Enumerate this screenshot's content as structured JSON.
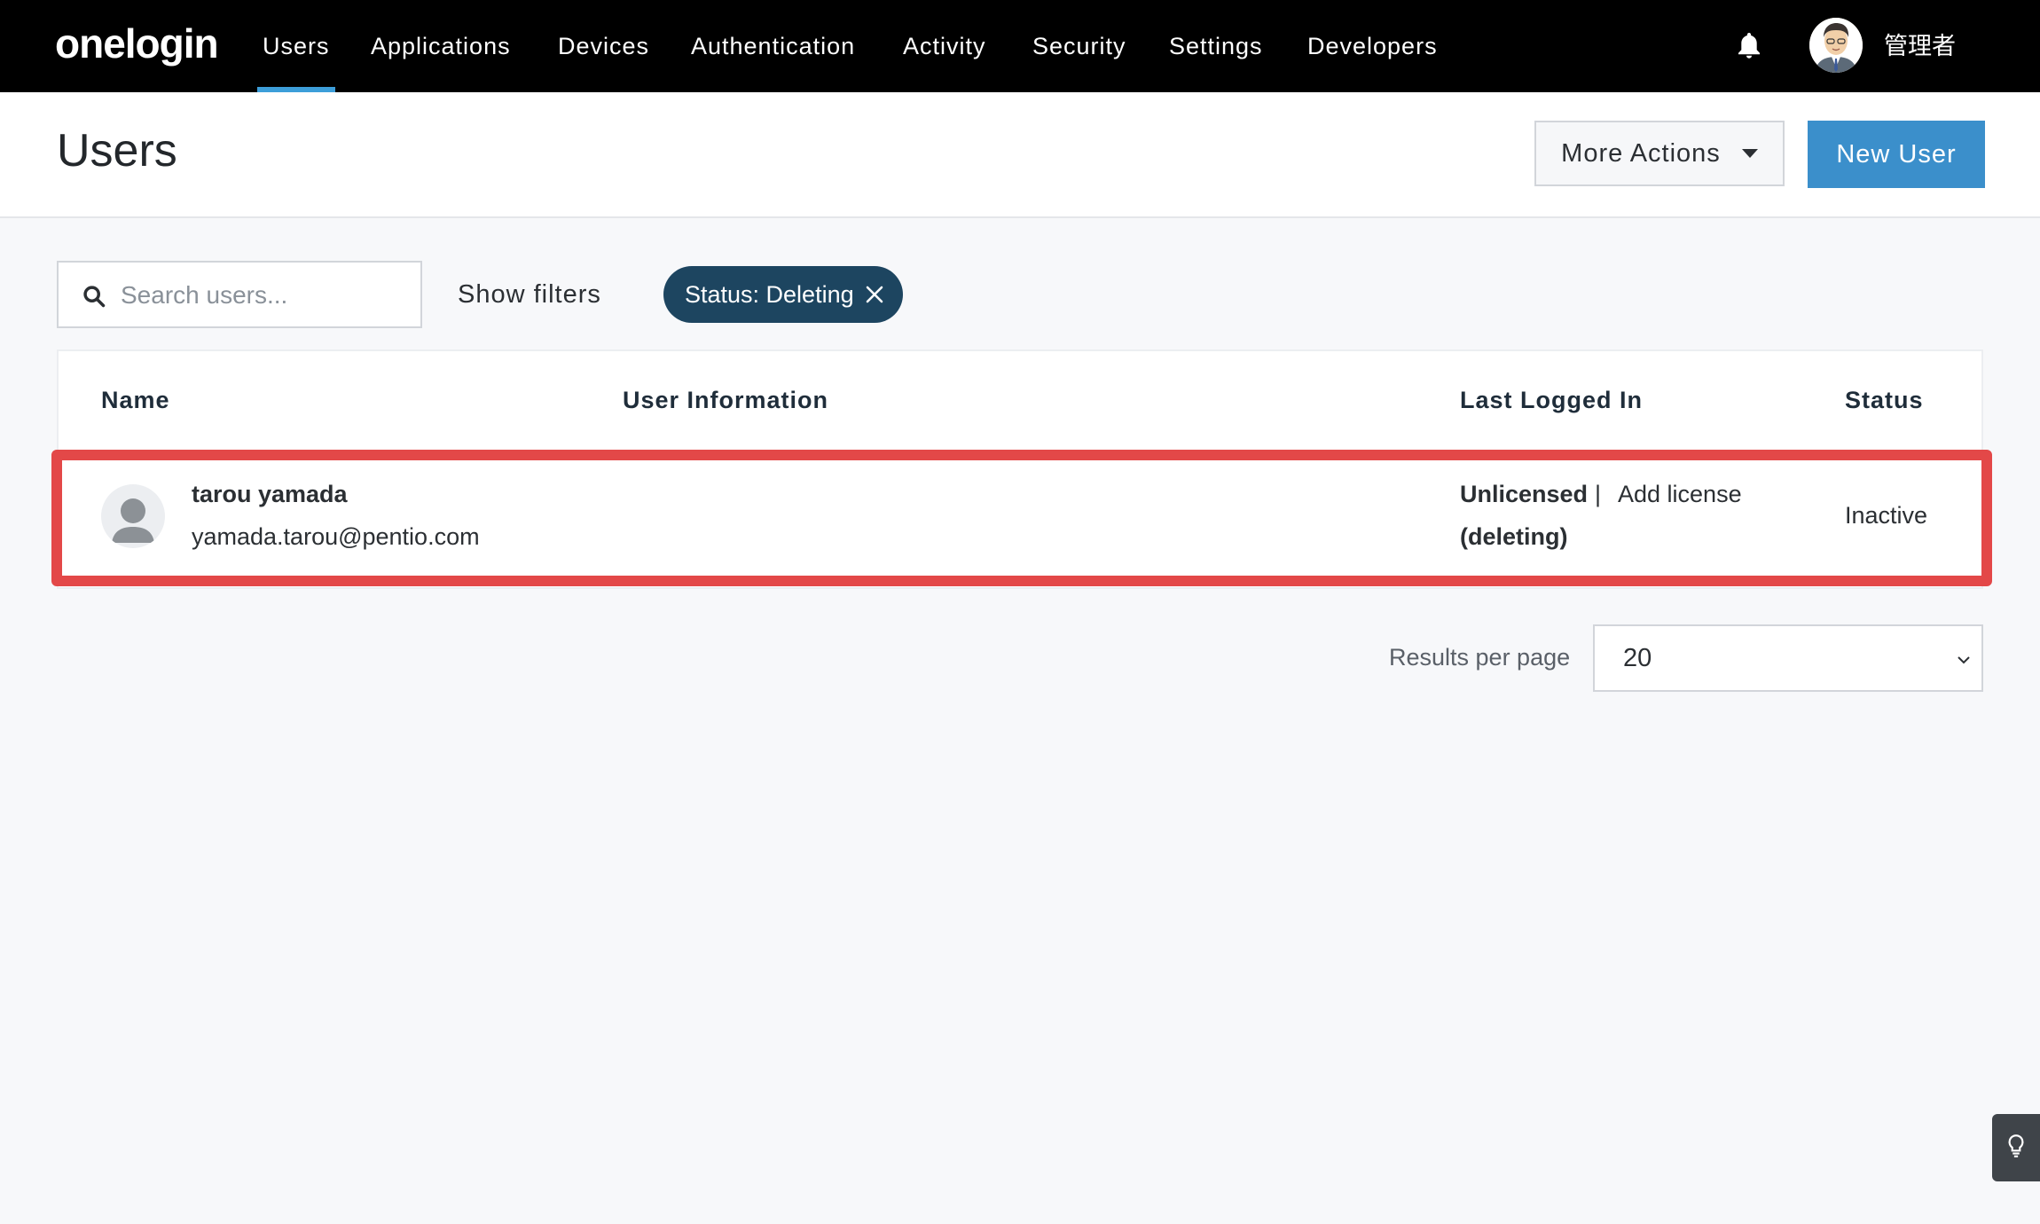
{
  "app": {
    "logo": "onelogin",
    "nav": [
      {
        "label": "Users",
        "active": true
      },
      {
        "label": "Applications"
      },
      {
        "label": "Devices"
      },
      {
        "label": "Authentication"
      },
      {
        "label": "Activity"
      },
      {
        "label": "Security"
      },
      {
        "label": "Settings"
      },
      {
        "label": "Developers"
      }
    ],
    "user_name": "管理者",
    "icons": {
      "notifications": "bell-icon",
      "profile": "user-avatar-icon"
    }
  },
  "header": {
    "title": "Users",
    "more_actions_label": "More Actions",
    "new_user_label": "New User"
  },
  "filters": {
    "search_placeholder": "Search users...",
    "search_value": "",
    "show_filters_label": "Show filters",
    "active_chip": "Status: Deleting"
  },
  "table": {
    "columns": [
      "Name",
      "User Information",
      "Last Logged In",
      "Status"
    ],
    "rows": [
      {
        "name": "tarou yamada",
        "email": "yamada.tarou@pentio.com",
        "license": "Unlicensed",
        "separator": "|",
        "add_license": "Add license",
        "last_logged_in": "(deleting)",
        "status": "Inactive"
      }
    ]
  },
  "pagination": {
    "results_per_page_label": "Results per page",
    "results_per_page_value": "20"
  },
  "colors": {
    "nav_bg": "#000000",
    "accent": "#3b8fcb",
    "chip_bg": "#1d4560",
    "highlight": "#e34848"
  }
}
